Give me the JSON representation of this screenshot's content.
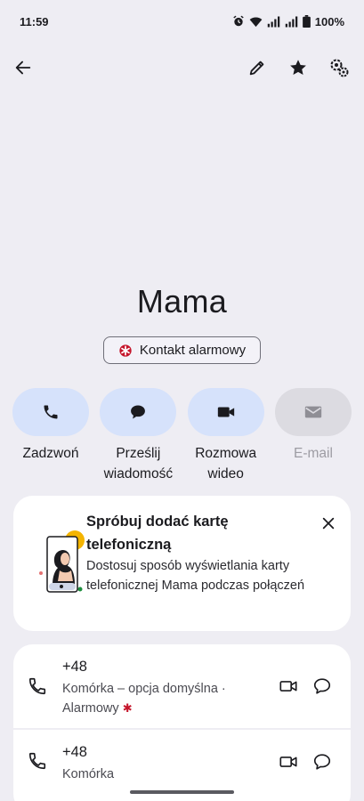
{
  "status_bar": {
    "time": "11:59",
    "battery": "100%",
    "icons": [
      "alarm-icon",
      "wifi-icon",
      "signal-icon",
      "signal-icon",
      "battery-icon"
    ]
  },
  "top_bar": {
    "icons": [
      "back-arrow-icon",
      "edit-pencil-icon",
      "star-icon",
      "settings-gear-icon"
    ]
  },
  "contact": {
    "name": "Mama",
    "emergency_chip": "Kontakt alarmowy"
  },
  "actions": [
    {
      "line1": "Zadzwoń",
      "line2": "",
      "icon": "phone-icon",
      "enabled": true
    },
    {
      "line1": "Prześlij",
      "line2": "wiadomość",
      "icon": "message-icon",
      "enabled": true
    },
    {
      "line1": "Rozmowa",
      "line2": "wideo",
      "icon": "video-icon",
      "enabled": true
    },
    {
      "line1": "E-mail",
      "line2": "",
      "icon": "mail-icon",
      "enabled": false
    }
  ],
  "promo": {
    "title": "Spróbuj dodać kartę telefoniczną",
    "body": "Dostosuj sposób wyświetlania karty telefonicznej Mama podczas połączeń"
  },
  "phones": [
    {
      "number": "+48",
      "type": "Komórka – opcja domyślna ·",
      "type2": "Alarmowy",
      "emergency_star": "✱"
    },
    {
      "number": "+48",
      "type": "Komórka"
    }
  ],
  "colors": {
    "background": "#eeedf3",
    "action_pill": "#d6e2fb",
    "action_pill_disabled": "#dcdbe1",
    "emergency_red": "#c5152b"
  }
}
